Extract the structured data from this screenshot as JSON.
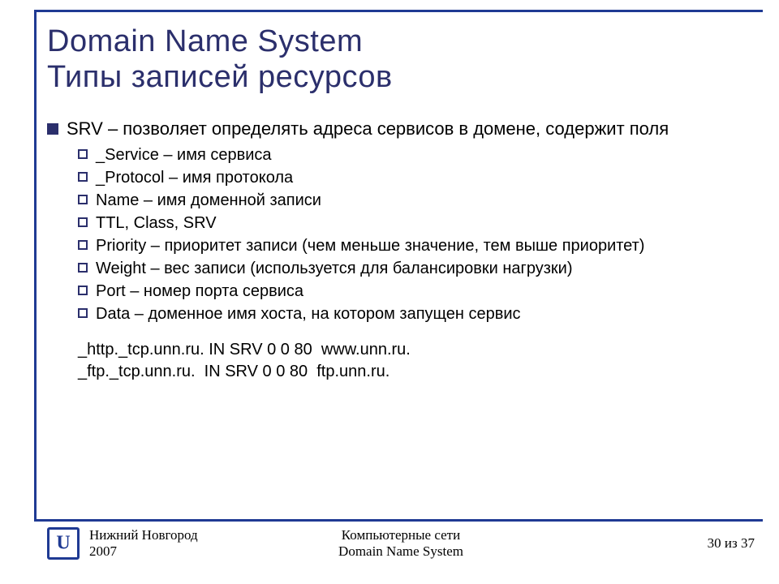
{
  "title": {
    "line1": "Domain Name System",
    "line2": "Типы записей ресурсов"
  },
  "main_bullet": "SRV – позволяет определять адреса сервисов в домене, содержит поля",
  "sub_bullets": [
    "_Service – имя сервиса",
    "_Protocol – имя протокола",
    "Name – имя доменной записи",
    "TTL, Class, SRV",
    "Priority – приоритет записи (чем меньше значение, тем выше приоритет)",
    "Weight – вес записи (используется для балансировки нагрузки)",
    "Port – номер порта сервиса",
    "Data – доменное имя хоста, на котором запущен сервис"
  ],
  "examples": {
    "l1": "_http._tcp.unn.ru. IN SRV 0 0 80  www.unn.ru.",
    "l2": "_ftp._tcp.unn.ru.  IN SRV 0 0 80  ftp.unn.ru."
  },
  "footer": {
    "left_line1": "Нижний Новгород",
    "left_line2": "2007",
    "center_line1": "Компьютерные сети",
    "center_line2": "Domain Name System",
    "right": "30 из 37"
  }
}
